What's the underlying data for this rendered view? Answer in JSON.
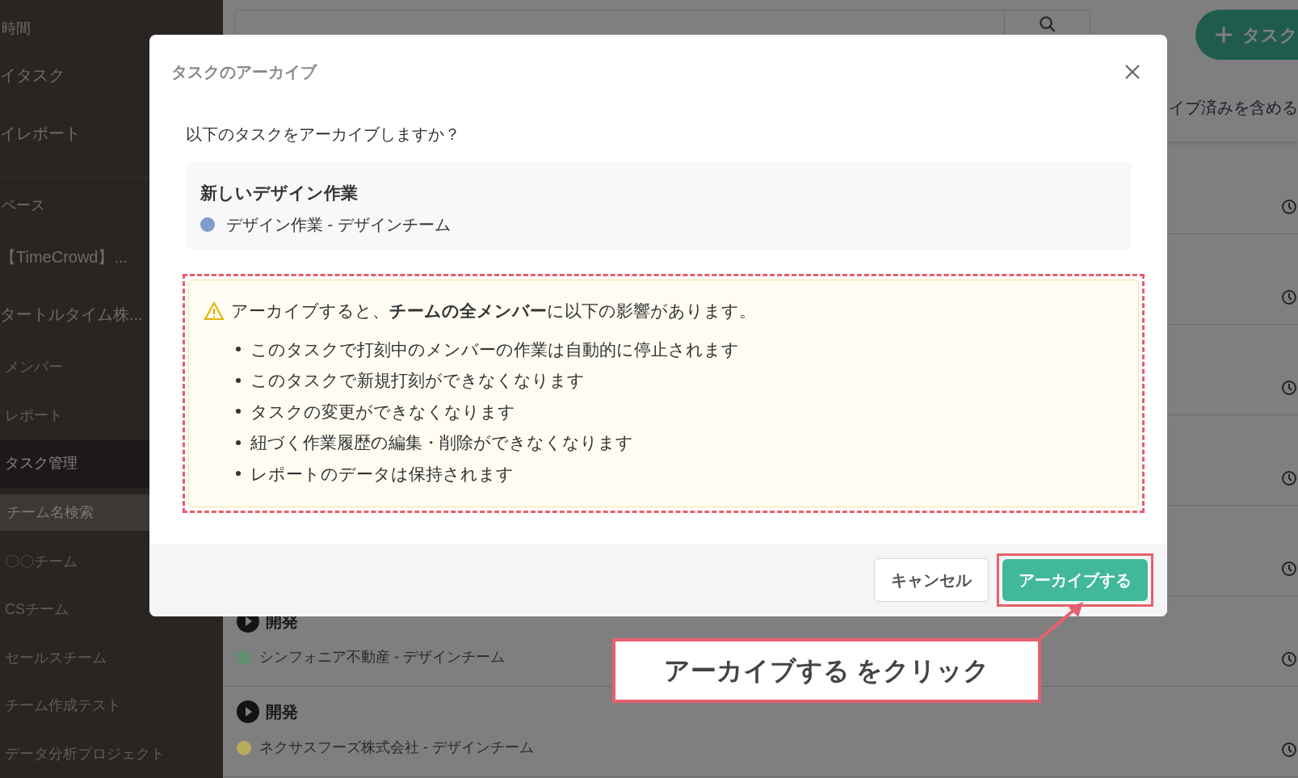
{
  "sidebar": {
    "items": [
      {
        "kind": "section",
        "label": "時間"
      },
      {
        "kind": "nav",
        "label": "イタスク",
        "selected": false
      },
      {
        "kind": "nav",
        "label": "イレポート",
        "selected": false
      },
      {
        "kind": "section",
        "label": "ペース"
      },
      {
        "kind": "nav",
        "label": "【TimeCrowd】...",
        "selected": false
      },
      {
        "kind": "nav",
        "label": "タートルタイム株...",
        "selected": false
      },
      {
        "kind": "sub",
        "label": "メンバー",
        "selected": false
      },
      {
        "kind": "sub",
        "label": "レポート",
        "selected": false
      },
      {
        "kind": "sub",
        "label": "タスク管理",
        "selected": true
      },
      {
        "kind": "search",
        "placeholder": "チーム名検索"
      },
      {
        "kind": "sub",
        "label": "〇〇チーム",
        "selected": false
      },
      {
        "kind": "sub",
        "label": "CSチーム",
        "selected": false
      },
      {
        "kind": "sub",
        "label": "セールスチーム",
        "selected": false
      },
      {
        "kind": "sub",
        "label": "チーム作成テスト",
        "selected": false
      },
      {
        "kind": "sub",
        "label": "データ分析プロジェクト",
        "selected": false
      }
    ]
  },
  "main": {
    "add_button": {
      "label": "タスク"
    },
    "archived_toggle": {
      "label": "イブ済みを含める"
    },
    "rows": [
      {
        "kind": "covered"
      },
      {
        "kind": "covered"
      },
      {
        "kind": "covered"
      },
      {
        "kind": "covered"
      },
      {
        "kind": "covered"
      },
      {
        "kind": "task",
        "title": "開発",
        "subtitle": "シンフォニア不動産 - デザインチーム",
        "color": "#5e8f6e"
      },
      {
        "kind": "task",
        "title": "開発",
        "subtitle": "ネクサスフーズ株式会社 - デザインチーム",
        "color": "#b5ad5a"
      }
    ]
  },
  "dialog": {
    "title": "タスクのアーカイブ",
    "question": "以下のタスクをアーカイブしますか？",
    "task": {
      "title": "新しいデザイン作業",
      "subtitle": "デザイン作業 - デザインチーム",
      "color": "#7f9ccc"
    },
    "warning": "アーカイブすると、**チームの全メンバー**に以下の影響があります。",
    "effects": [
      "このタスクで打刻中のメンバーの作業は自動的に停止されます",
      "このタスクで新規打刻ができなくなります",
      "タスクの変更ができなくなります",
      "紐づく作業履歴の編集・削除ができなくなります",
      "レポートのデータは保持されます"
    ],
    "buttons": [
      {
        "kind": "secondary",
        "label": "キャンセル"
      },
      {
        "kind": "primary",
        "label": "アーカイブする"
      }
    ]
  },
  "callout": {
    "text": "アーカイブする をクリック"
  }
}
